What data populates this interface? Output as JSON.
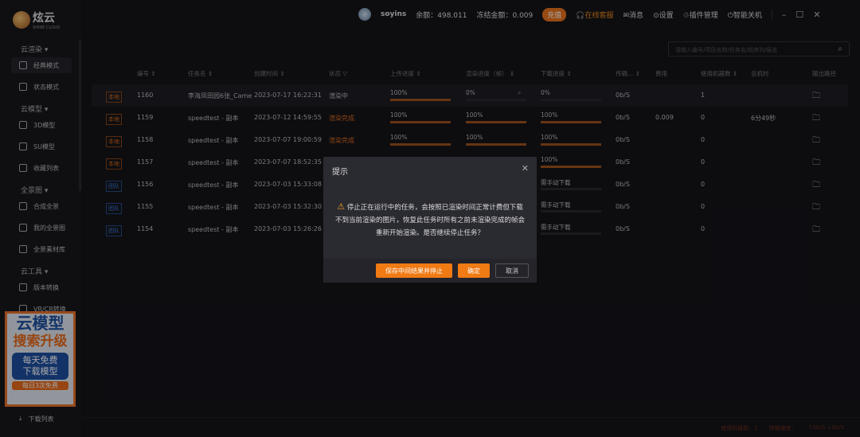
{
  "app": {
    "logo_text": "炫云",
    "logo_sub": "SHINE CLOUD"
  },
  "sidebar": {
    "sections": [
      {
        "label": "云渲染 ▾",
        "items": [
          {
            "label": "经典模式",
            "icon": "cloud-icon",
            "active": true
          },
          {
            "label": "状态模式",
            "icon": "chart-icon"
          }
        ]
      },
      {
        "label": "云模型 ▾",
        "items": [
          {
            "label": "3D模型",
            "icon": "cube-icon"
          },
          {
            "label": "SU模型",
            "icon": "su-icon"
          },
          {
            "label": "收藏列表",
            "icon": "favorite-icon"
          }
        ]
      },
      {
        "label": "全景图 ▾",
        "items": [
          {
            "label": "合成全景",
            "icon": "panorama-icon"
          },
          {
            "label": "我的全景图",
            "icon": "planet-icon"
          },
          {
            "label": "全景素材库",
            "icon": "library-icon"
          }
        ]
      },
      {
        "label": "云工具 ▾",
        "items": [
          {
            "label": "版本转换",
            "icon": "convert-icon"
          },
          {
            "label": "VR/CR转换",
            "icon": "vr-icon"
          }
        ]
      }
    ],
    "download_list": "下载列表",
    "ad": {
      "line1": "云模型",
      "line2": "搜索升级",
      "line3": "每天免费",
      "line4": "下载模型",
      "line5": "每日3次免费"
    }
  },
  "topbar": {
    "username": "soyins",
    "balance": "余额：498.011",
    "frozen": "冻结金额：0.009",
    "recharge": "充值",
    "support": "在线客服",
    "messages": "消息",
    "settings": "设置",
    "plugins": "插件管理",
    "shutdown": "智能关机"
  },
  "search": {
    "placeholder": "请输入编号/项目名称/任务名/帧序列/层名"
  },
  "table": {
    "headers": [
      "编号 ⇕",
      "任务名 ⇕",
      "创建时间 ⇕",
      "状态 ▽",
      "上传进度 ⇕",
      "渲染进度（帧） ⇕",
      "下载进度 ⇕",
      "传输... ⇕",
      "费用",
      "使用机器数 ⇕",
      "总机时",
      "输出路径"
    ],
    "rows": [
      {
        "tag": "本地",
        "tag_type": "local",
        "id": "1160",
        "name": "李海凤田园6张_Camer",
        "created": "2023-07-17 16:22:31",
        "status": "渲染中",
        "status_color": "#bbbbbb",
        "upload": "100%",
        "upload_pct": 100,
        "render": "0%",
        "render_pct": 0,
        "download": "0%",
        "download_pct": 0,
        "speed": "0b/S",
        "cost": "",
        "machines": "1",
        "hours": ""
      },
      {
        "tag": "本地",
        "tag_type": "local",
        "id": "1159",
        "name": "speedtest - 副本",
        "created": "2023-07-12 14:59:55",
        "status": "渲染完成",
        "status_color": "#d86a1c",
        "upload": "100%",
        "upload_pct": 100,
        "render": "100%",
        "render_pct": 100,
        "download": "100%",
        "download_pct": 100,
        "speed": "0b/S",
        "cost": "0.009",
        "machines": "0",
        "hours": "6分49秒"
      },
      {
        "tag": "本地",
        "tag_type": "local",
        "id": "1158",
        "name": "speedtest - 副本",
        "created": "2023-07-07 19:00:59",
        "status": "渲染完成",
        "status_color": "#d86a1c",
        "upload": "100%",
        "upload_pct": 100,
        "render": "100%",
        "render_pct": 100,
        "download": "100%",
        "download_pct": 100,
        "speed": "0b/S",
        "cost": "",
        "machines": "0",
        "hours": ""
      },
      {
        "tag": "本地",
        "tag_type": "local",
        "id": "1157",
        "name": "speedtest - 副本",
        "created": "2023-07-07 18:52:35",
        "status": "",
        "status_color": "#bbbbbb",
        "upload": "",
        "upload_pct": null,
        "render": "",
        "render_pct": null,
        "download": "100%",
        "download_pct": 100,
        "speed": "0b/S",
        "cost": "",
        "machines": "0",
        "hours": ""
      },
      {
        "tag": "团队",
        "tag_type": "team",
        "id": "1156",
        "name": "speedtest - 副本",
        "created": "2023-07-03 15:33:08",
        "status": "",
        "status_color": "#bbbbbb",
        "upload": "",
        "upload_pct": null,
        "render": "",
        "render_pct": null,
        "download": "需手动下载",
        "download_pct": 0,
        "speed": "0b/S",
        "cost": "",
        "machines": "0",
        "hours": ""
      },
      {
        "tag": "团队",
        "tag_type": "team",
        "id": "1155",
        "name": "speedtest - 副本",
        "created": "2023-07-03 15:32:30",
        "status": "",
        "status_color": "#bbbbbb",
        "upload": "",
        "upload_pct": null,
        "render": "",
        "render_pct": null,
        "download": "需手动下载",
        "download_pct": 0,
        "speed": "0b/S",
        "cost": "",
        "machines": "0",
        "hours": ""
      },
      {
        "tag": "团队",
        "tag_type": "team",
        "id": "1154",
        "name": "speedtest - 副本",
        "created": "2023-07-03 15:26:26",
        "status": "",
        "status_color": "#bbbbbb",
        "upload": "",
        "upload_pct": null,
        "render": "",
        "render_pct": null,
        "download": "需手动下载",
        "download_pct": 0,
        "speed": "0b/S",
        "cost": "",
        "machines": "0",
        "hours": ""
      }
    ]
  },
  "modal": {
    "title": "提示",
    "message": "停止正在运行中的任务，会按照已渲染时间正常计费但下载不到当前渲染的图片，恢复此任务时所有之前未渲染完成的帧会重新开始渲染。是否继续停止任务？",
    "save_stop": "保存中间结果并停止",
    "confirm": "确定",
    "cancel": "取消"
  },
  "footer": {
    "machines": "使用机器数：1",
    "speed": "传输速度：",
    "rate": "↑0b/S ↓0b/S"
  },
  "colors": {
    "accent": "#f07a14",
    "bg": "#14141a"
  }
}
